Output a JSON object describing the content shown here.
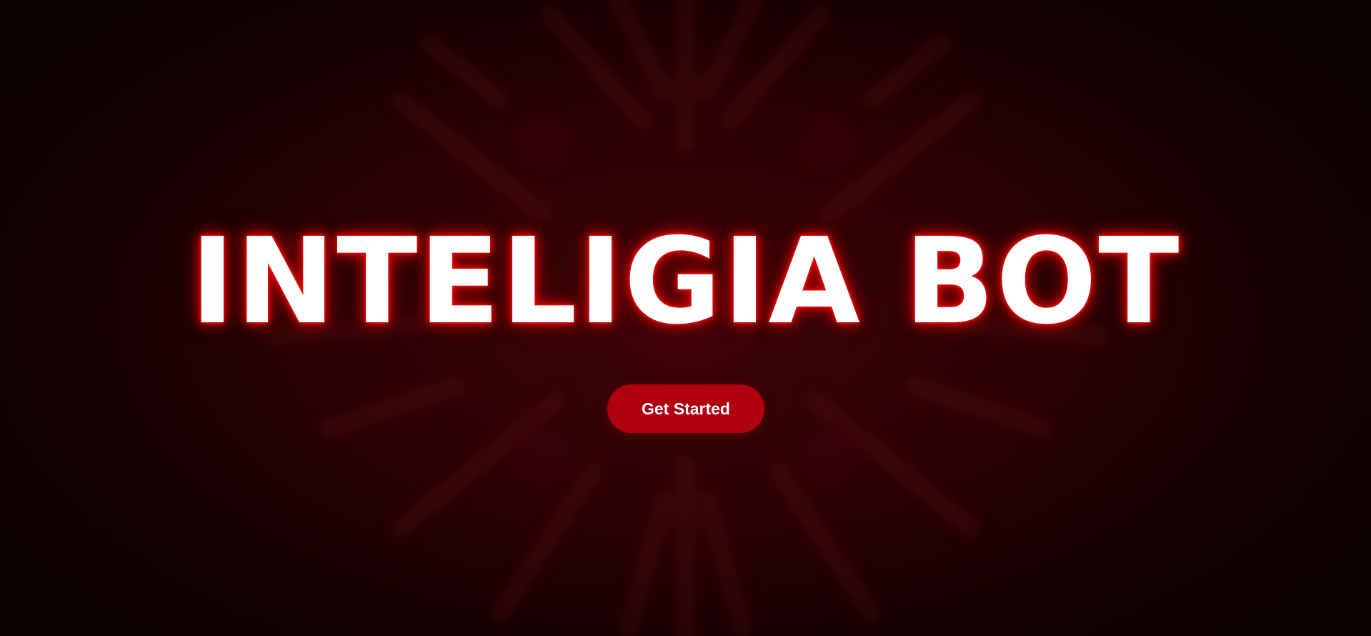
{
  "hero": {
    "title": "INTELIGIA BOT",
    "cta_label": "Get Started"
  },
  "colors": {
    "background": "#2a0204",
    "title_text": "#ffffff",
    "title_glow": "#e00000",
    "button_background": "#b0000f",
    "button_text": "#ffffff"
  }
}
